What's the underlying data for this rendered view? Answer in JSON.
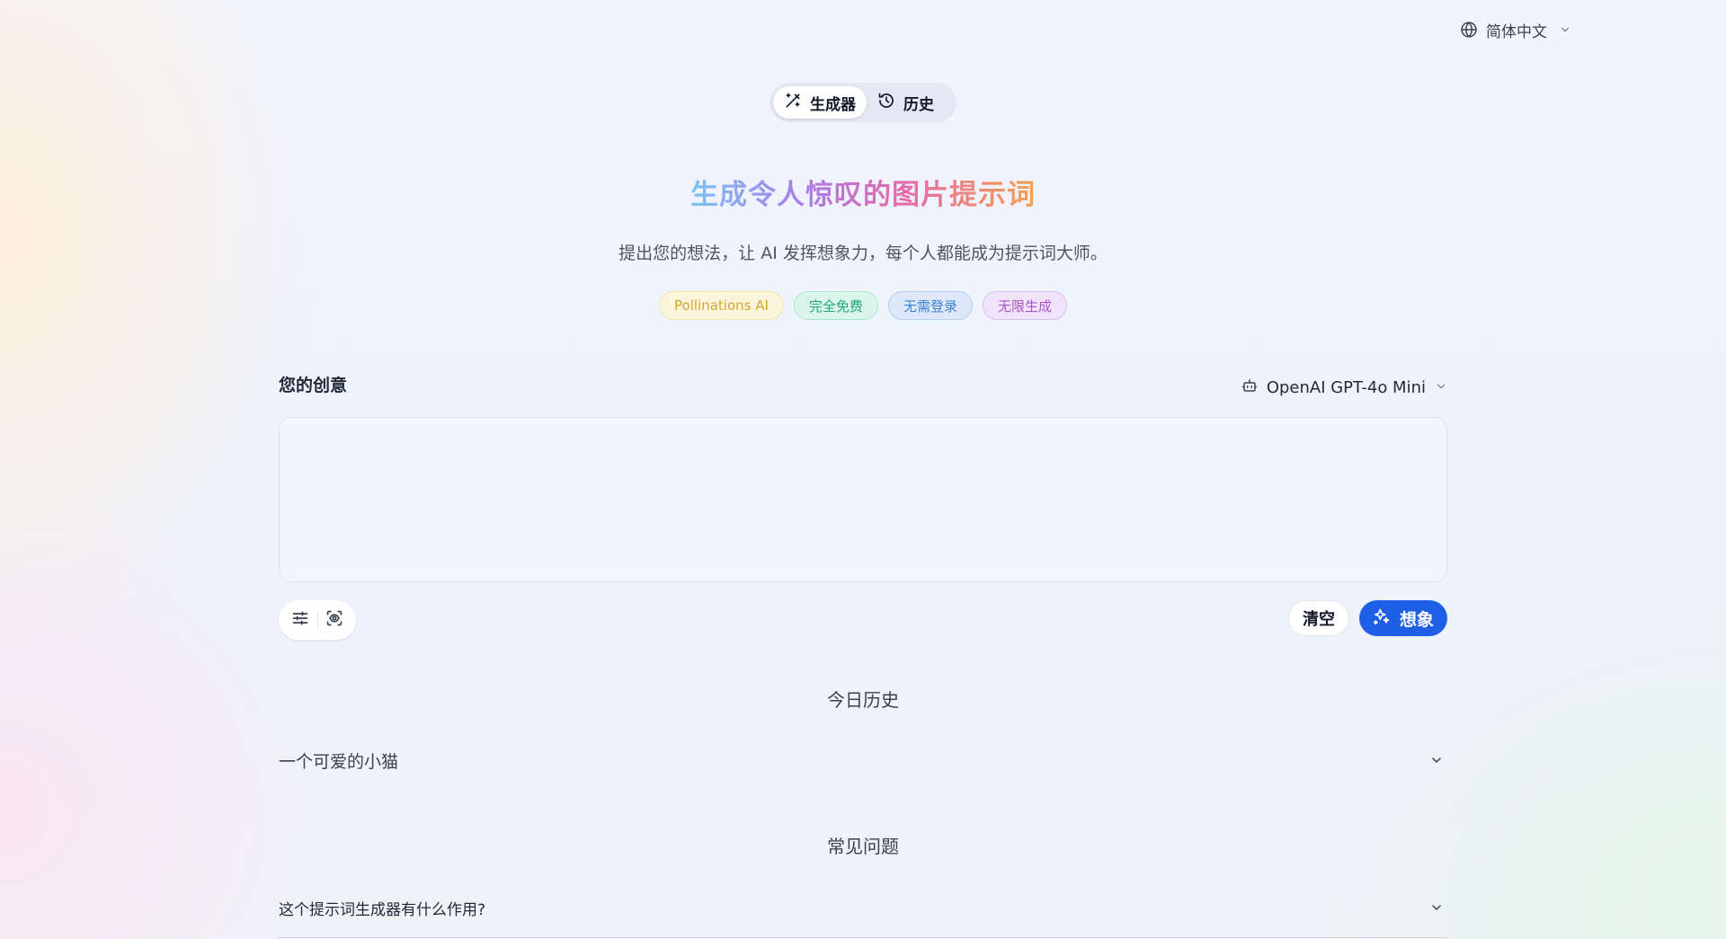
{
  "header": {
    "language_label": "简体中文"
  },
  "tabs": [
    {
      "label": "生成器",
      "icon": "magic-wand-icon",
      "active": true
    },
    {
      "label": "历史",
      "icon": "history-icon",
      "active": false
    }
  ],
  "hero": {
    "title": "生成令人惊叹的图片提示词",
    "subtitle": "提出您的想法，让 AI 发挥想象力，每个人都能成为提示词大师。",
    "gradient_colors": [
      "#7cc4f2",
      "#a77de6",
      "#e56aa9",
      "#f4a24e"
    ]
  },
  "badges": [
    {
      "label": "Pollinations AI",
      "color": "#d4a52a",
      "bg": "#fbf5dc",
      "border": "#f3e4a6"
    },
    {
      "label": "完全免费",
      "color": "#1fa878",
      "bg": "#dcf5ec",
      "border": "#a9e6cf"
    },
    {
      "label": "无需登录",
      "color": "#3b82d6",
      "bg": "#dde9fb",
      "border": "#b3cdf3"
    },
    {
      "label": "无限生成",
      "color": "#a855c9",
      "bg": "#f1e3fa",
      "border": "#dcbdf0"
    }
  ],
  "creative": {
    "label": "您的创意",
    "model": "OpenAI GPT-4o Mini",
    "prompt_value": ""
  },
  "actions": {
    "clear_label": "清空",
    "imagine_label": "想象",
    "accent_color": "#1e5fe6"
  },
  "history": {
    "heading": "今日历史",
    "items": [
      "一个可爱的小猫"
    ]
  },
  "faq": {
    "heading": "常见问题",
    "items": [
      "这个提示词生成器有什么作用?"
    ]
  }
}
